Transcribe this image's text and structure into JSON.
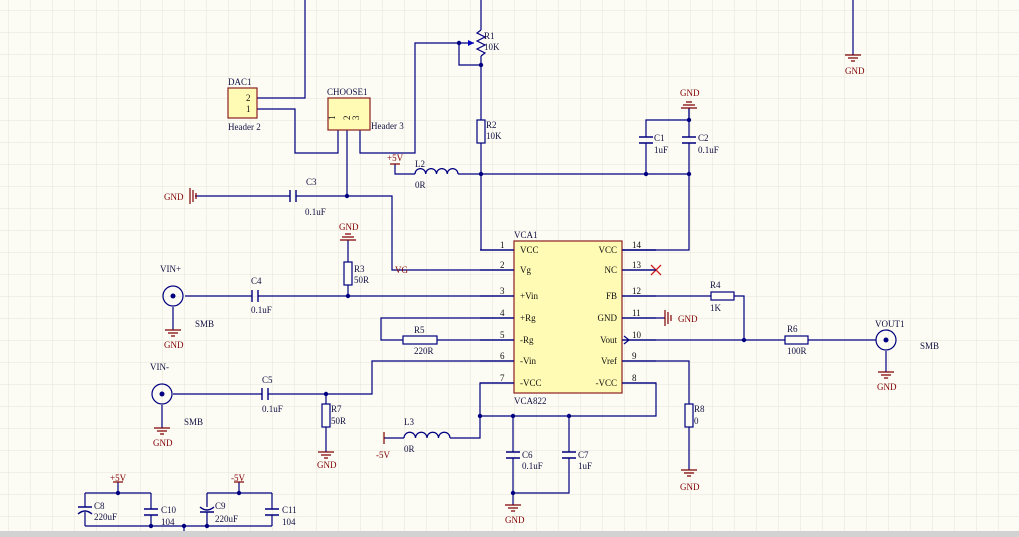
{
  "power": {
    "gnd": "GND",
    "p5v": "+5V",
    "n5v": "-5V"
  },
  "nets": {
    "vg": "VG"
  },
  "connectors": {
    "dac1": {
      "designator": "DAC1",
      "comment": "Header 2",
      "pins": [
        "2",
        "1"
      ]
    },
    "choose1": {
      "designator": "CHOOSE1",
      "comment": "Header 3",
      "pins": [
        "1",
        "2",
        "3"
      ]
    },
    "vin_p": {
      "designator": "VIN+",
      "comment": "SMB"
    },
    "vin_n": {
      "designator": "VIN-",
      "comment": "SMB"
    },
    "vout1": {
      "designator": "VOUT1",
      "comment": "SMB"
    }
  },
  "ic": {
    "designator": "VCA1",
    "comment": "VCA822",
    "left_pins": [
      {
        "num": "1",
        "name": "VCC"
      },
      {
        "num": "2",
        "name": "Vg"
      },
      {
        "num": "3",
        "name": "+Vin"
      },
      {
        "num": "4",
        "name": "+Rg"
      },
      {
        "num": "5",
        "name": "-Rg"
      },
      {
        "num": "6",
        "name": "-Vin"
      },
      {
        "num": "7",
        "name": "-VCC"
      }
    ],
    "right_pins": [
      {
        "num": "14",
        "name": "VCC"
      },
      {
        "num": "13",
        "name": "NC"
      },
      {
        "num": "12",
        "name": "FB"
      },
      {
        "num": "11",
        "name": "GND"
      },
      {
        "num": "10",
        "name": "Vout"
      },
      {
        "num": "9",
        "name": "Vref"
      },
      {
        "num": "8",
        "name": "-VCC"
      }
    ]
  },
  "components": {
    "R1": {
      "designator": "R1",
      "value": "10K"
    },
    "R2": {
      "designator": "R2",
      "value": "10K"
    },
    "R3": {
      "designator": "R3",
      "value": "50R"
    },
    "R4": {
      "designator": "R4",
      "value": "1K"
    },
    "R5": {
      "designator": "R5",
      "value": "220R"
    },
    "R6": {
      "designator": "R6",
      "value": "100R"
    },
    "R7": {
      "designator": "R7",
      "value": "50R"
    },
    "R8": {
      "designator": "R8",
      "value": "0"
    },
    "L2": {
      "designator": "L2",
      "value": "0R"
    },
    "L3": {
      "designator": "L3",
      "value": "0R"
    },
    "C1": {
      "designator": "C1",
      "value": "1uF"
    },
    "C2": {
      "designator": "C2",
      "value": "0.1uF"
    },
    "C3": {
      "designator": "C3",
      "value": "0.1uF"
    },
    "C4": {
      "designator": "C4",
      "value": "0.1uF"
    },
    "C5": {
      "designator": "C5",
      "value": "0.1uF"
    },
    "C6": {
      "designator": "C6",
      "value": "0.1uF"
    },
    "C7": {
      "designator": "C7",
      "value": "1uF"
    },
    "C8": {
      "designator": "C8",
      "value": "220uF"
    },
    "C9": {
      "designator": "C9",
      "value": "220uF"
    },
    "C10": {
      "designator": "C10",
      "value": "104"
    },
    "C11": {
      "designator": "C11",
      "value": "104"
    }
  },
  "colors": {
    "wire": "#000080",
    "power": "#800000",
    "part_fill": "#fffbb4",
    "part_border": "#8b2020",
    "sheet": "#fcfbf4"
  }
}
